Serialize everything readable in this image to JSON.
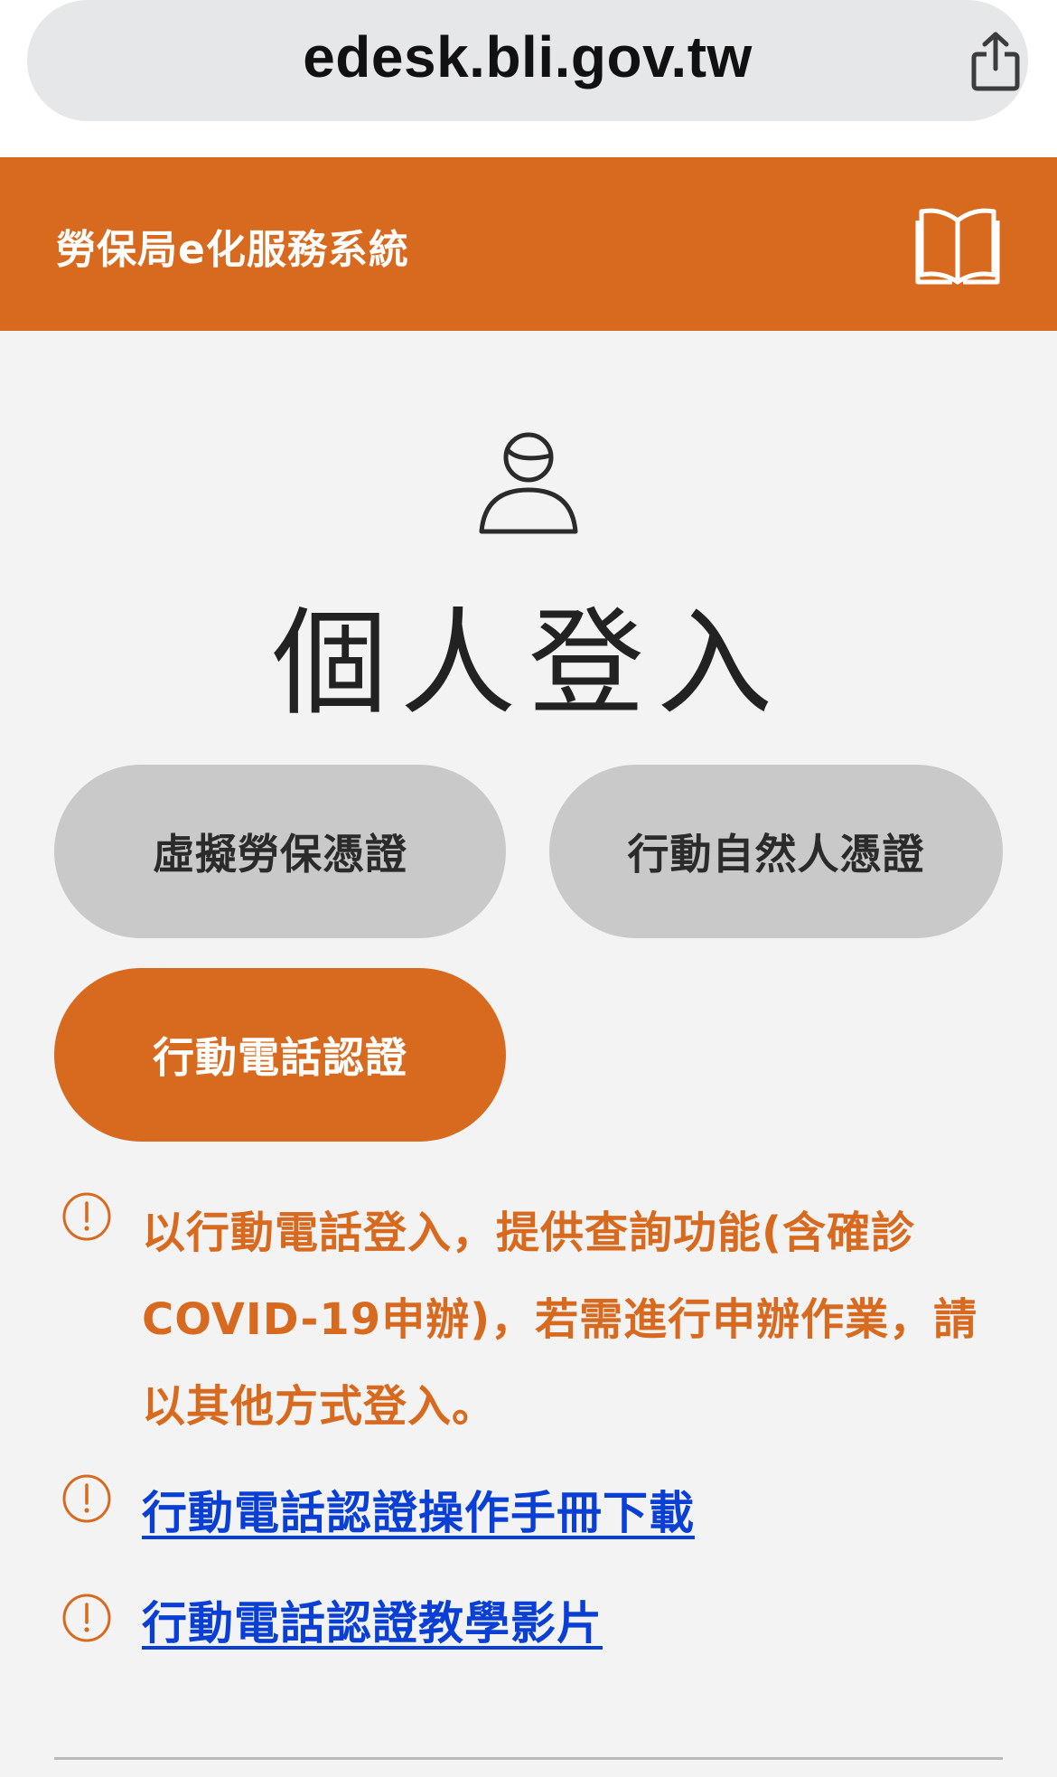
{
  "browser": {
    "url": "edesk.bli.gov.tw",
    "share_icon": "share-icon"
  },
  "header": {
    "title": "勞保局e化服務系統",
    "book_icon": "book-icon",
    "color": "#d86a1f"
  },
  "login": {
    "user_icon": "user-icon",
    "title": "個人登入"
  },
  "buttons": {
    "virtual_cert": "虛擬勞保憑證",
    "mobile_id_cert": "行動自然人憑證",
    "phone_auth": "行動電話認證"
  },
  "notice": {
    "icon": "info-icon",
    "text": "以行動電話登入，提供查詢功能(含確診COVID-19申辦)，若需進行申辦作業，請以其他方式登入。",
    "color": "#d86a1f"
  },
  "links": {
    "manual": "行動電話認證操作手冊下載",
    "video": "行動電話認證教學影片",
    "color": "#0a3fd6"
  }
}
